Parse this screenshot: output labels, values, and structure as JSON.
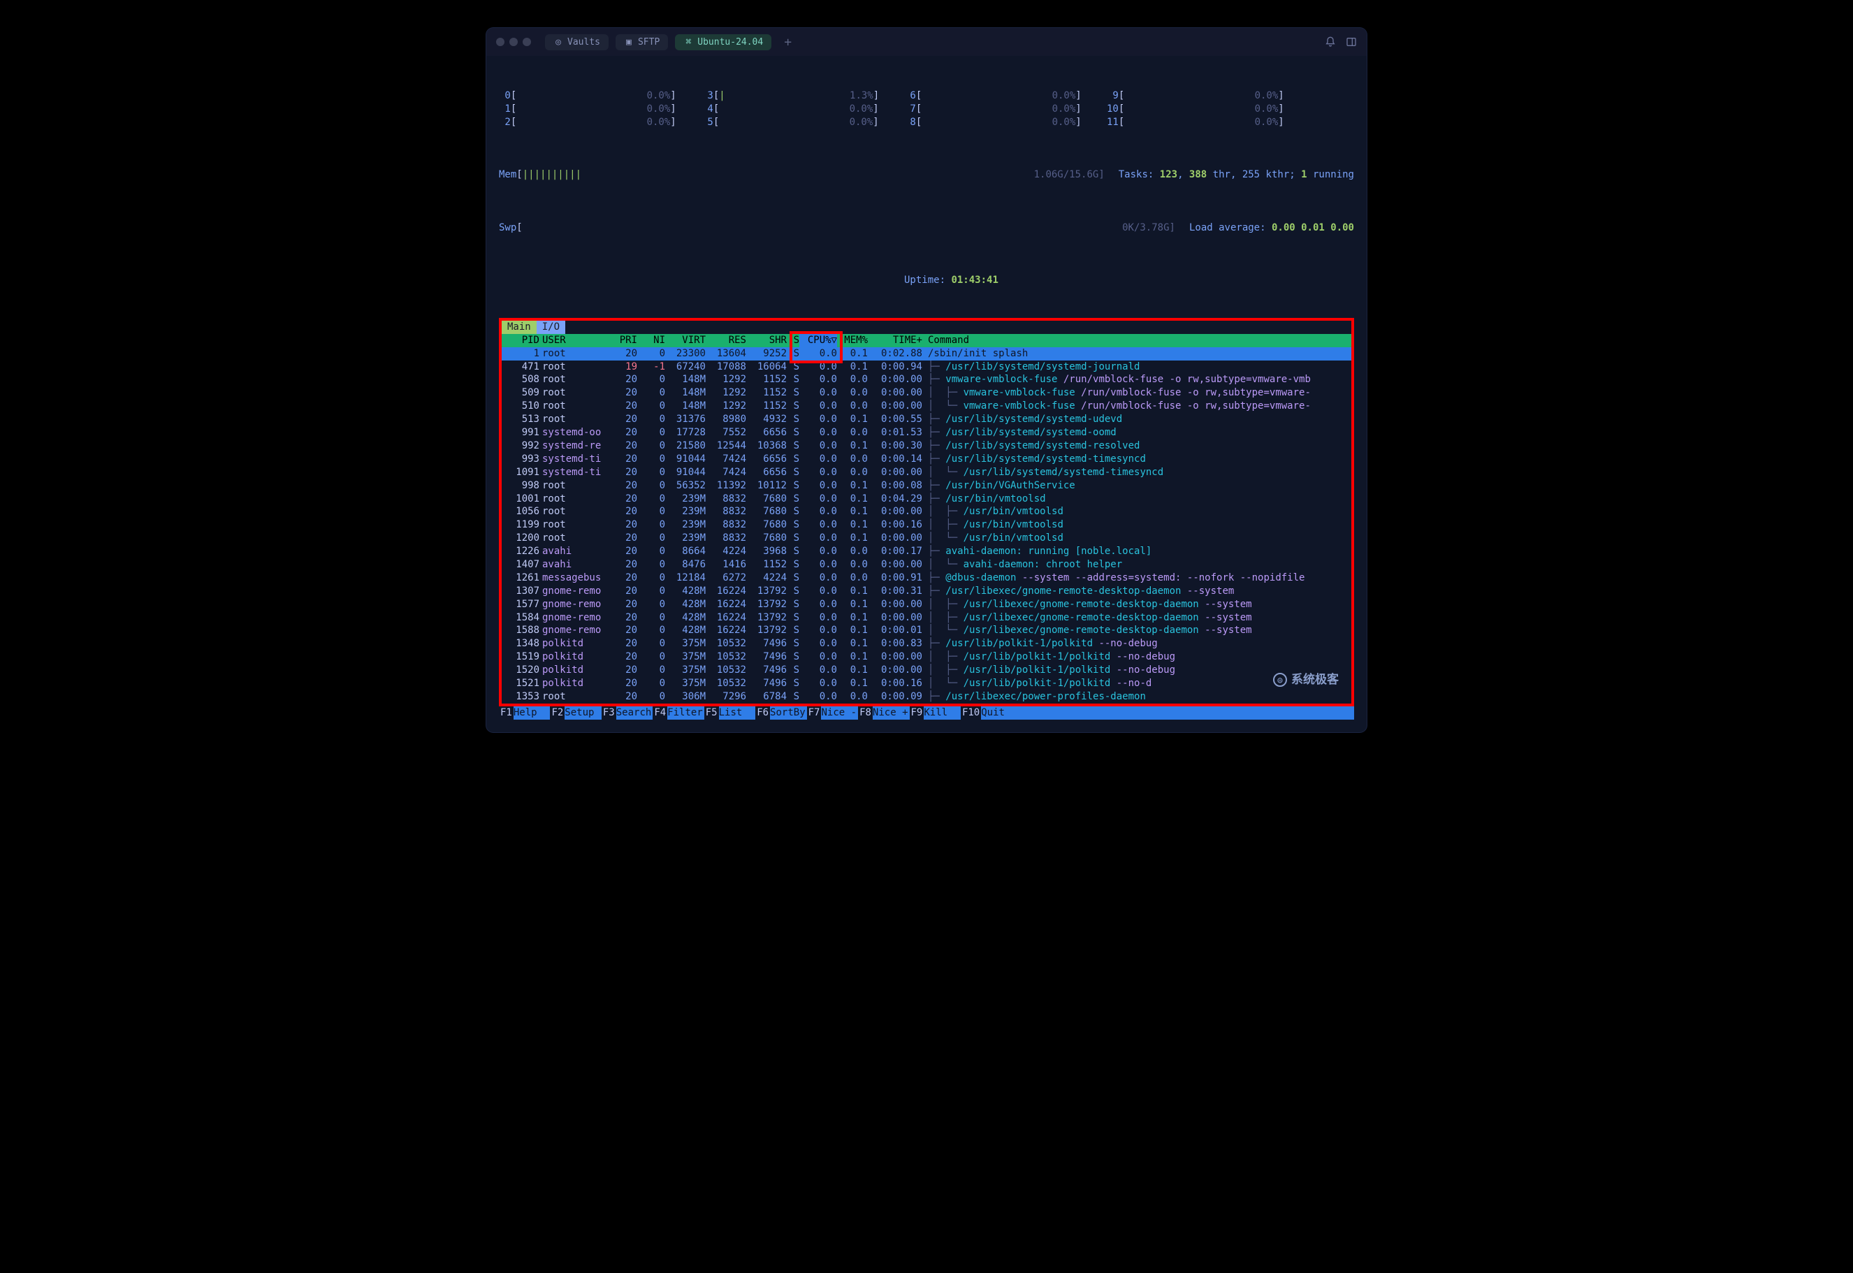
{
  "titlebar": {
    "tabs": [
      {
        "icon": "vault",
        "label": "Vaults"
      },
      {
        "icon": "folder",
        "label": "SFTP"
      },
      {
        "icon": "terminal",
        "label": "Ubuntu-24.04",
        "active": true
      }
    ],
    "add_label": "+"
  },
  "meters": {
    "cpus": [
      {
        "id": "0",
        "bar": "[",
        "fill": "",
        "pct": "0.0%",
        "close": "]"
      },
      {
        "id": "1",
        "bar": "[",
        "fill": "",
        "pct": "0.0%",
        "close": "]"
      },
      {
        "id": "2",
        "bar": "[",
        "fill": "",
        "pct": "0.0%",
        "close": "]"
      },
      {
        "id": "3",
        "bar": "[",
        "fill": "|",
        "pct": "1.3%",
        "close": "]"
      },
      {
        "id": "4",
        "bar": "[",
        "fill": "",
        "pct": "0.0%",
        "close": "]"
      },
      {
        "id": "5",
        "bar": "[",
        "fill": "",
        "pct": "0.0%",
        "close": "]"
      },
      {
        "id": "6",
        "bar": "[",
        "fill": "",
        "pct": "0.0%",
        "close": "]"
      },
      {
        "id": "7",
        "bar": "[",
        "fill": "",
        "pct": "0.0%",
        "close": "]"
      },
      {
        "id": "8",
        "bar": "[",
        "fill": "",
        "pct": "0.0%",
        "close": "]"
      },
      {
        "id": "9",
        "bar": "[",
        "fill": "",
        "pct": "0.0%",
        "close": "]"
      },
      {
        "id": "10",
        "bar": "[",
        "fill": "",
        "pct": "0.0%",
        "close": "]"
      },
      {
        "id": "11",
        "bar": "[",
        "fill": "",
        "pct": "0.0%",
        "close": "]"
      }
    ],
    "mem_label": "Mem",
    "mem_bar": "||||||||||",
    "mem_val": "1.06G/15.6G",
    "swp_label": "Swp",
    "swp_bar": "",
    "swp_val": "0K/3.78G",
    "tasks_label": "Tasks:",
    "tasks_count": "123",
    "tasks_thr": "388",
    "tasks_thr_label": "thr,",
    "tasks_kthr": "255 kthr;",
    "tasks_running": "1",
    "tasks_running_label": "running",
    "load_label": "Load average:",
    "load_vals": "0.00 0.01 0.00",
    "uptime_label": "Uptime:",
    "uptime_val": "01:43:41"
  },
  "panel_tabs": {
    "main": "Main",
    "io": "I/O"
  },
  "columns": {
    "pid": "PID",
    "user": "USER",
    "pri": "PRI",
    "ni": "NI",
    "virt": "VIRT",
    "res": "RES",
    "shr": "SHR",
    "s": "S",
    "cpu": "CPU%▽",
    "mem": "MEM%",
    "time": "TIME+",
    "cmd": "Command"
  },
  "selected_index": 0,
  "processes": [
    {
      "pid": "1",
      "user": "root",
      "pri": "20",
      "ni": "0",
      "virt": "23300",
      "res": "13604",
      "shr": "9252",
      "s": "S",
      "cpu": "0.0",
      "mem": "0.1",
      "time": "0:02.88",
      "tree": "",
      "cmd": "/sbin/init",
      "args": " splash"
    },
    {
      "pid": "471",
      "user": "root",
      "pri": "19",
      "pri_red": true,
      "ni": "-1",
      "ni_red": true,
      "virt": "67240",
      "res": "17088",
      "shr": "16064",
      "s": "S",
      "cpu": "0.0",
      "mem": "0.1",
      "time": "0:00.94",
      "tree": "├─ ",
      "cmd": "/usr/lib/systemd/systemd-journald",
      "args": ""
    },
    {
      "pid": "508",
      "user": "root",
      "pri": "20",
      "ni": "0",
      "virt": "148M",
      "res": "1292",
      "shr": "1152",
      "s": "S",
      "cpu": "0.0",
      "mem": "0.0",
      "time": "0:00.00",
      "tree": "├─ ",
      "cmd": "vmware-vmblock-fuse",
      "args": " /run/vmblock-fuse -o rw,subtype=vmware-vmb"
    },
    {
      "pid": "509",
      "user": "root",
      "pri": "20",
      "ni": "0",
      "virt": "148M",
      "res": "1292",
      "shr": "1152",
      "s": "S",
      "cpu": "0.0",
      "mem": "0.0",
      "time": "0:00.00",
      "tree": "│  ├─ ",
      "cmd": "vmware-vmblock-fuse",
      "args": " /run/vmblock-fuse -o rw,subtype=vmware-"
    },
    {
      "pid": "510",
      "user": "root",
      "pri": "20",
      "ni": "0",
      "virt": "148M",
      "res": "1292",
      "shr": "1152",
      "s": "S",
      "cpu": "0.0",
      "mem": "0.0",
      "time": "0:00.00",
      "tree": "│  └─ ",
      "cmd": "vmware-vmblock-fuse",
      "args": " /run/vmblock-fuse -o rw,subtype=vmware-"
    },
    {
      "pid": "513",
      "user": "root",
      "pri": "20",
      "ni": "0",
      "virt": "31376",
      "res": "8980",
      "shr": "4932",
      "s": "S",
      "cpu": "0.0",
      "mem": "0.1",
      "time": "0:00.55",
      "tree": "├─ ",
      "cmd": "/usr/lib/systemd/systemd-udevd",
      "args": ""
    },
    {
      "pid": "991",
      "user": "systemd-oo",
      "magenta": true,
      "pri": "20",
      "ni": "0",
      "virt": "17728",
      "res": "7552",
      "shr": "6656",
      "s": "S",
      "cpu": "0.0",
      "mem": "0.0",
      "time": "0:01.53",
      "tree": "├─ ",
      "cmd": "/usr/lib/systemd/systemd-oomd",
      "args": ""
    },
    {
      "pid": "992",
      "user": "systemd-re",
      "magenta": true,
      "pri": "20",
      "ni": "0",
      "virt": "21580",
      "res": "12544",
      "shr": "10368",
      "s": "S",
      "cpu": "0.0",
      "mem": "0.1",
      "time": "0:00.30",
      "tree": "├─ ",
      "cmd": "/usr/lib/systemd/systemd-resolved",
      "args": ""
    },
    {
      "pid": "993",
      "user": "systemd-ti",
      "magenta": true,
      "pri": "20",
      "ni": "0",
      "virt": "91044",
      "res": "7424",
      "shr": "6656",
      "s": "S",
      "cpu": "0.0",
      "mem": "0.0",
      "time": "0:00.14",
      "tree": "├─ ",
      "cmd": "/usr/lib/systemd/systemd-timesyncd",
      "args": ""
    },
    {
      "pid": "1091",
      "user": "systemd-ti",
      "magenta": true,
      "pri": "20",
      "ni": "0",
      "virt": "91044",
      "res": "7424",
      "shr": "6656",
      "s": "S",
      "cpu": "0.0",
      "mem": "0.0",
      "time": "0:00.00",
      "tree": "│  └─ ",
      "cmd": "/usr/lib/systemd/systemd-timesyncd",
      "args": ""
    },
    {
      "pid": "998",
      "user": "root",
      "pri": "20",
      "ni": "0",
      "virt": "56352",
      "res": "11392",
      "shr": "10112",
      "s": "S",
      "cpu": "0.0",
      "mem": "0.1",
      "time": "0:00.08",
      "tree": "├─ ",
      "cmd": "/usr/bin/VGAuthService",
      "args": ""
    },
    {
      "pid": "1001",
      "user": "root",
      "pri": "20",
      "ni": "0",
      "virt": "239M",
      "res": "8832",
      "shr": "7680",
      "s": "S",
      "cpu": "0.0",
      "mem": "0.1",
      "time": "0:04.29",
      "tree": "├─ ",
      "cmd": "/usr/bin/vmtoolsd",
      "args": ""
    },
    {
      "pid": "1056",
      "user": "root",
      "pri": "20",
      "ni": "0",
      "virt": "239M",
      "res": "8832",
      "shr": "7680",
      "s": "S",
      "cpu": "0.0",
      "mem": "0.1",
      "time": "0:00.00",
      "tree": "│  ├─ ",
      "cmd": "/usr/bin/vmtoolsd",
      "args": ""
    },
    {
      "pid": "1199",
      "user": "root",
      "pri": "20",
      "ni": "0",
      "virt": "239M",
      "res": "8832",
      "shr": "7680",
      "s": "S",
      "cpu": "0.0",
      "mem": "0.1",
      "time": "0:00.16",
      "tree": "│  ├─ ",
      "cmd": "/usr/bin/vmtoolsd",
      "args": ""
    },
    {
      "pid": "1200",
      "user": "root",
      "pri": "20",
      "ni": "0",
      "virt": "239M",
      "res": "8832",
      "shr": "7680",
      "s": "S",
      "cpu": "0.0",
      "mem": "0.1",
      "time": "0:00.00",
      "tree": "│  └─ ",
      "cmd": "/usr/bin/vmtoolsd",
      "args": ""
    },
    {
      "pid": "1226",
      "user": "avahi",
      "magenta": true,
      "pri": "20",
      "ni": "0",
      "virt": "8664",
      "res": "4224",
      "shr": "3968",
      "s": "S",
      "cpu": "0.0",
      "mem": "0.0",
      "time": "0:00.17",
      "tree": "├─ ",
      "cmd": "avahi-daemon: running [noble.local]",
      "args": ""
    },
    {
      "pid": "1407",
      "user": "avahi",
      "magenta": true,
      "pri": "20",
      "ni": "0",
      "virt": "8476",
      "res": "1416",
      "shr": "1152",
      "s": "S",
      "cpu": "0.0",
      "mem": "0.0",
      "time": "0:00.00",
      "tree": "│  └─ ",
      "cmd": "avahi-daemon: chroot helper",
      "args": ""
    },
    {
      "pid": "1261",
      "user": "messagebus",
      "magenta": true,
      "pri": "20",
      "ni": "0",
      "virt": "12184",
      "res": "6272",
      "shr": "4224",
      "s": "S",
      "cpu": "0.0",
      "mem": "0.0",
      "time": "0:00.91",
      "tree": "├─ ",
      "cmd": "@dbus-daemon",
      "args": " --system --address=systemd: --nofork --nopidfile"
    },
    {
      "pid": "1307",
      "user": "gnome-remo",
      "magenta": true,
      "pri": "20",
      "ni": "0",
      "virt": "428M",
      "res": "16224",
      "shr": "13792",
      "s": "S",
      "cpu": "0.0",
      "mem": "0.1",
      "time": "0:00.31",
      "tree": "├─ ",
      "cmd": "/usr/libexec/gnome-remote-desktop-daemon",
      "args": " --system"
    },
    {
      "pid": "1577",
      "user": "gnome-remo",
      "magenta": true,
      "pri": "20",
      "ni": "0",
      "virt": "428M",
      "res": "16224",
      "shr": "13792",
      "s": "S",
      "cpu": "0.0",
      "mem": "0.1",
      "time": "0:00.00",
      "tree": "│  ├─ ",
      "cmd": "/usr/libexec/gnome-remote-desktop-daemon",
      "args": " --system"
    },
    {
      "pid": "1584",
      "user": "gnome-remo",
      "magenta": true,
      "pri": "20",
      "ni": "0",
      "virt": "428M",
      "res": "16224",
      "shr": "13792",
      "s": "S",
      "cpu": "0.0",
      "mem": "0.1",
      "time": "0:00.00",
      "tree": "│  ├─ ",
      "cmd": "/usr/libexec/gnome-remote-desktop-daemon",
      "args": " --system"
    },
    {
      "pid": "1588",
      "user": "gnome-remo",
      "magenta": true,
      "pri": "20",
      "ni": "0",
      "virt": "428M",
      "res": "16224",
      "shr": "13792",
      "s": "S",
      "cpu": "0.0",
      "mem": "0.1",
      "time": "0:00.01",
      "tree": "│  └─ ",
      "cmd": "/usr/libexec/gnome-remote-desktop-daemon",
      "args": " --system"
    },
    {
      "pid": "1348",
      "user": "polkitd",
      "magenta": true,
      "pri": "20",
      "ni": "0",
      "virt": "375M",
      "res": "10532",
      "shr": "7496",
      "s": "S",
      "cpu": "0.0",
      "mem": "0.1",
      "time": "0:00.83",
      "tree": "├─ ",
      "cmd": "/usr/lib/polkit-1/polkitd",
      "args": " --no-debug"
    },
    {
      "pid": "1519",
      "user": "polkitd",
      "magenta": true,
      "pri": "20",
      "ni": "0",
      "virt": "375M",
      "res": "10532",
      "shr": "7496",
      "s": "S",
      "cpu": "0.0",
      "mem": "0.1",
      "time": "0:00.00",
      "tree": "│  ├─ ",
      "cmd": "/usr/lib/polkit-1/polkitd",
      "args": " --no-debug"
    },
    {
      "pid": "1520",
      "user": "polkitd",
      "magenta": true,
      "pri": "20",
      "ni": "0",
      "virt": "375M",
      "res": "10532",
      "shr": "7496",
      "s": "S",
      "cpu": "0.0",
      "mem": "0.1",
      "time": "0:00.00",
      "tree": "│  ├─ ",
      "cmd": "/usr/lib/polkit-1/polkitd",
      "args": " --no-debug"
    },
    {
      "pid": "1521",
      "user": "polkitd",
      "magenta": true,
      "pri": "20",
      "ni": "0",
      "virt": "375M",
      "res": "10532",
      "shr": "7496",
      "s": "S",
      "cpu": "0.0",
      "mem": "0.1",
      "time": "0:00.16",
      "tree": "│  └─ ",
      "cmd": "/usr/lib/polkit-1/polkitd",
      "args": " --no-d"
    },
    {
      "pid": "1353",
      "user": "root",
      "pri": "20",
      "ni": "0",
      "virt": "306M",
      "res": "7296",
      "shr": "6784",
      "s": "S",
      "cpu": "0.0",
      "mem": "0.0",
      "time": "0:00.09",
      "tree": "├─ ",
      "cmd": "/usr/libexec/power-profiles-daemon",
      "args": ""
    }
  ],
  "fkeys": [
    {
      "key": "F1",
      "label": "Help  "
    },
    {
      "key": "F2",
      "label": "Setup "
    },
    {
      "key": "F3",
      "label": "Search"
    },
    {
      "key": "F4",
      "label": "Filter"
    },
    {
      "key": "F5",
      "label": "List  "
    },
    {
      "key": "F6",
      "label": "SortBy"
    },
    {
      "key": "F7",
      "label": "Nice -"
    },
    {
      "key": "F8",
      "label": "Nice +"
    },
    {
      "key": "F9",
      "label": "Kill  "
    },
    {
      "key": "F10",
      "label": "Quit  "
    }
  ],
  "watermark": "系统极客"
}
